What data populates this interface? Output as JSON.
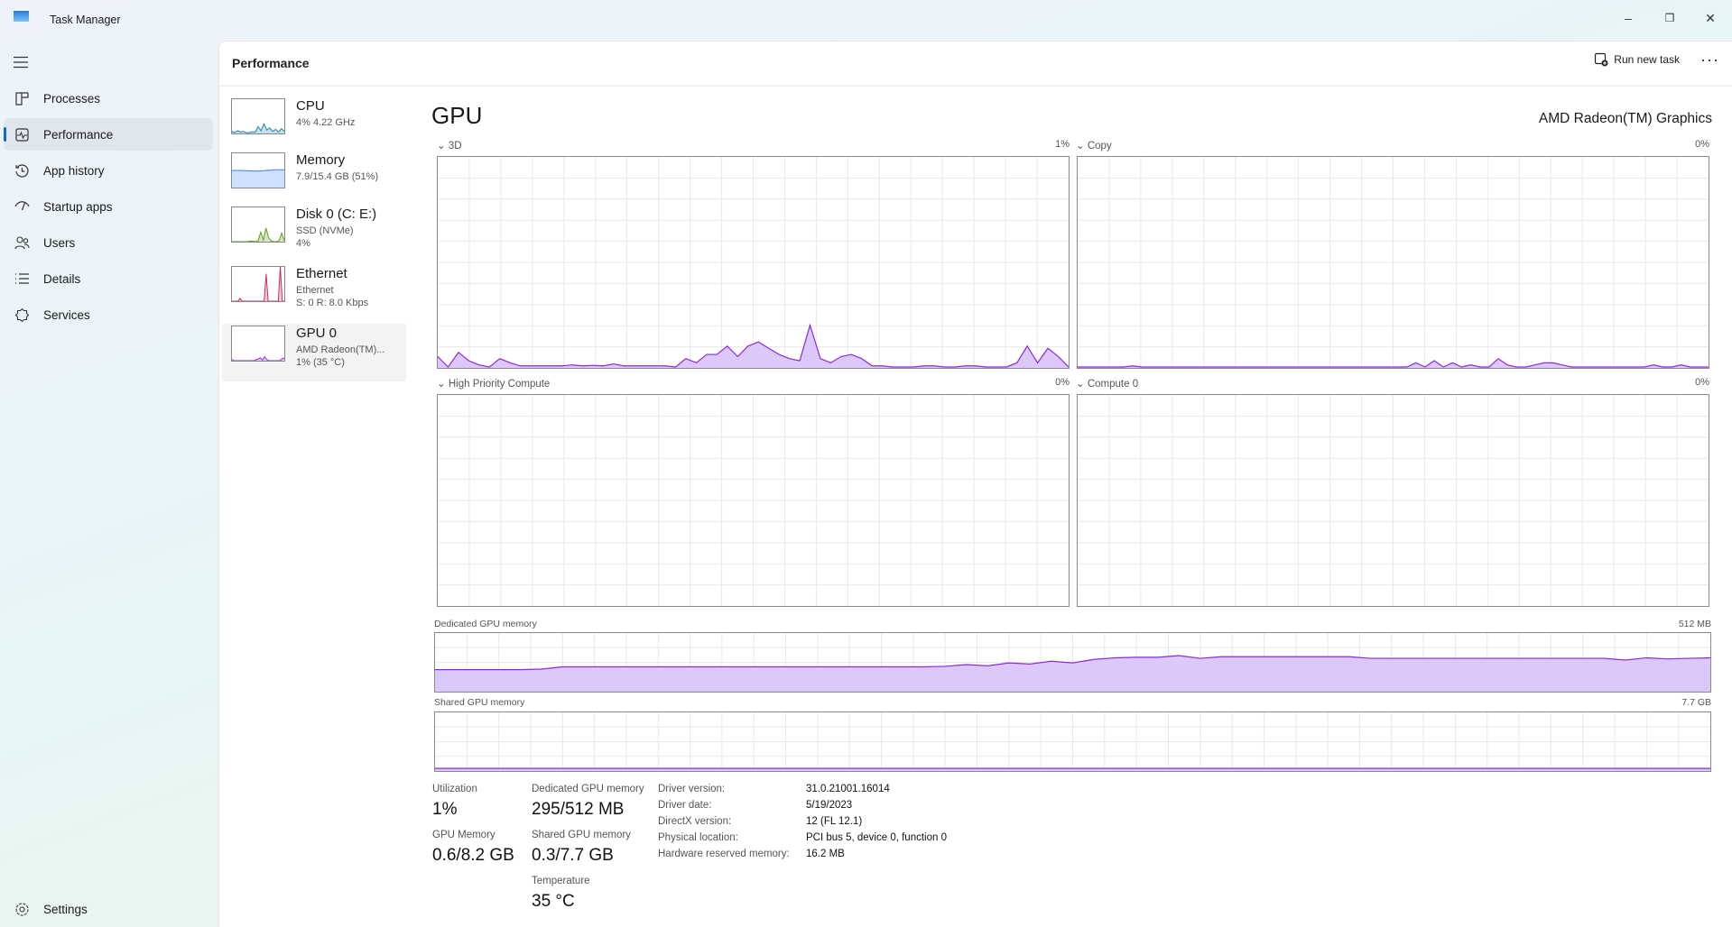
{
  "app": {
    "title": "Task Manager"
  },
  "window": {
    "minimize": "–",
    "restore": "❐",
    "close": "✕"
  },
  "nav": {
    "items": [
      {
        "label": "Processes",
        "icon": "processes-icon"
      },
      {
        "label": "Performance",
        "icon": "performance-icon"
      },
      {
        "label": "App history",
        "icon": "history-icon"
      },
      {
        "label": "Startup apps",
        "icon": "startup-icon"
      },
      {
        "label": "Users",
        "icon": "users-icon"
      },
      {
        "label": "Details",
        "icon": "details-icon"
      },
      {
        "label": "Services",
        "icon": "services-icon"
      }
    ],
    "settings": "Settings"
  },
  "header": {
    "title": "Performance",
    "run_new_task": "Run new task",
    "more": "···"
  },
  "resources": [
    {
      "name": "CPU",
      "line1": "4%  4.22 GHz",
      "line2": "",
      "color": "#1b7fa8"
    },
    {
      "name": "Memory",
      "line1": "7.9/15.4 GB (51%)",
      "line2": "",
      "color": "#3b82f6"
    },
    {
      "name": "Disk 0 (C: E:)",
      "line1": "SSD (NVMe)",
      "line2": "4%",
      "color": "#5a9a16"
    },
    {
      "name": "Ethernet",
      "line1": "Ethernet",
      "line2": "S: 0  R: 8.0 Kbps",
      "color": "#d1245a"
    },
    {
      "name": "GPU 0",
      "line1": "AMD Radeon(TM)...",
      "line2": "1%  (35 °C)",
      "color": "#8a2be2"
    }
  ],
  "gpu": {
    "title": "GPU",
    "model": "AMD Radeon(TM) Graphics",
    "accent": "#8a2be2",
    "engines": [
      {
        "label": "3D",
        "value": "1%",
        "data": [
          5,
          0,
          7,
          3,
          1,
          0,
          4,
          2,
          0.5,
          0.5,
          0.5,
          0.5,
          0.5,
          1,
          0.5,
          0.8,
          0.5,
          1.5,
          0.5,
          0.5,
          0.5,
          0.5,
          0.5,
          0,
          4,
          2,
          6,
          6,
          10,
          5,
          10,
          12,
          9,
          6,
          4,
          3,
          20,
          4,
          2,
          5,
          6,
          4,
          0.5,
          0.5,
          0,
          0,
          0,
          0.5,
          0.5,
          0,
          0,
          0.5,
          0.5,
          0,
          0,
          0,
          2,
          10,
          2,
          9,
          5,
          0
        ]
      },
      {
        "label": "Copy",
        "value": "0%",
        "data": [
          0,
          0,
          0,
          0,
          0,
          0,
          0.5,
          0,
          0,
          0,
          0,
          0,
          0,
          0,
          0,
          0,
          0,
          0,
          0,
          0,
          0,
          0,
          0,
          0,
          0,
          0,
          0,
          0,
          0,
          0,
          0,
          0,
          0,
          0,
          0,
          0,
          0,
          2,
          0,
          3,
          0,
          2,
          0,
          1,
          0,
          0,
          4,
          1,
          0,
          0,
          1,
          2,
          2,
          1,
          0,
          0,
          0,
          0,
          0,
          0,
          0,
          0,
          0,
          1,
          0,
          0,
          1,
          0,
          0,
          0
        ]
      },
      {
        "label": "High Priority Compute",
        "value": "0%",
        "data": []
      },
      {
        "label": "Compute 0",
        "value": "0%",
        "data": []
      }
    ],
    "dedicated": {
      "label": "Dedicated GPU memory",
      "max": "512 MB",
      "data": [
        37,
        37,
        37,
        37,
        37,
        38,
        42,
        42,
        42,
        42,
        42,
        42,
        42,
        42,
        42,
        42,
        42,
        42,
        42,
        42,
        42,
        42,
        42,
        42,
        43,
        46,
        44,
        49,
        47,
        52,
        49,
        55,
        58,
        59,
        59,
        62,
        57,
        60,
        60,
        60,
        60,
        60,
        60,
        60,
        57,
        57,
        57,
        57,
        57,
        57,
        57,
        57,
        57,
        57,
        57,
        57,
        54,
        58,
        56,
        57,
        58
      ]
    },
    "shared": {
      "label": "Shared GPU memory",
      "max": "7.7 GB",
      "data": [
        3,
        3,
        3,
        3,
        3,
        3,
        3,
        3,
        3,
        3,
        3,
        3,
        3,
        3,
        3,
        3,
        3,
        3,
        3,
        3,
        3
      ]
    },
    "stats": {
      "utilization_label": "Utilization",
      "utilization": "1%",
      "gpu_memory_label": "GPU Memory",
      "gpu_memory": "0.6/8.2 GB",
      "dedicated_label": "Dedicated GPU memory",
      "dedicated": "295/512 MB",
      "shared_label": "Shared GPU memory",
      "shared": "0.3/7.7 GB",
      "temperature_label": "Temperature",
      "temperature": "35 °C"
    },
    "info": [
      {
        "k": "Driver version:",
        "v": "31.0.21001.16014"
      },
      {
        "k": "Driver date:",
        "v": "5/19/2023"
      },
      {
        "k": "DirectX version:",
        "v": "12 (FL 12.1)"
      },
      {
        "k": "Physical location:",
        "v": "PCI bus 5, device 0, function 0"
      },
      {
        "k": "Hardware reserved memory:",
        "v": "16.2 MB"
      }
    ]
  }
}
